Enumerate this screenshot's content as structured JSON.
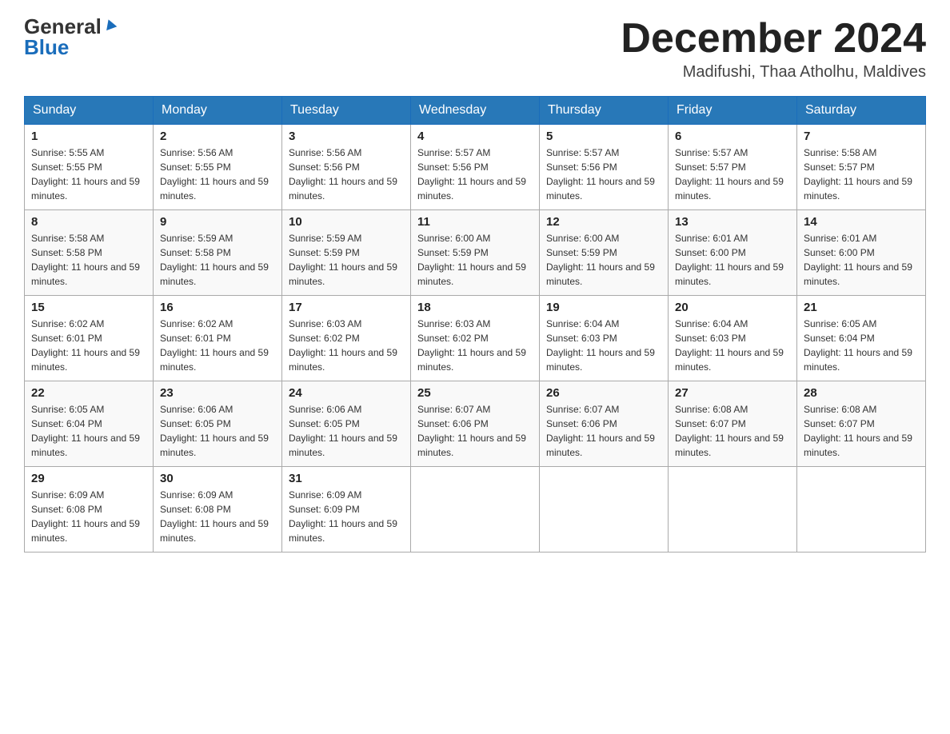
{
  "header": {
    "logo_general": "General",
    "logo_blue": "Blue",
    "title": "December 2024",
    "subtitle": "Madifushi, Thaa Atholhu, Maldives"
  },
  "weekdays": [
    "Sunday",
    "Monday",
    "Tuesday",
    "Wednesday",
    "Thursday",
    "Friday",
    "Saturday"
  ],
  "weeks": [
    [
      {
        "day": "1",
        "sunrise": "5:55 AM",
        "sunset": "5:55 PM",
        "daylight": "11 hours and 59 minutes."
      },
      {
        "day": "2",
        "sunrise": "5:56 AM",
        "sunset": "5:55 PM",
        "daylight": "11 hours and 59 minutes."
      },
      {
        "day": "3",
        "sunrise": "5:56 AM",
        "sunset": "5:56 PM",
        "daylight": "11 hours and 59 minutes."
      },
      {
        "day": "4",
        "sunrise": "5:57 AM",
        "sunset": "5:56 PM",
        "daylight": "11 hours and 59 minutes."
      },
      {
        "day": "5",
        "sunrise": "5:57 AM",
        "sunset": "5:56 PM",
        "daylight": "11 hours and 59 minutes."
      },
      {
        "day": "6",
        "sunrise": "5:57 AM",
        "sunset": "5:57 PM",
        "daylight": "11 hours and 59 minutes."
      },
      {
        "day": "7",
        "sunrise": "5:58 AM",
        "sunset": "5:57 PM",
        "daylight": "11 hours and 59 minutes."
      }
    ],
    [
      {
        "day": "8",
        "sunrise": "5:58 AM",
        "sunset": "5:58 PM",
        "daylight": "11 hours and 59 minutes."
      },
      {
        "day": "9",
        "sunrise": "5:59 AM",
        "sunset": "5:58 PM",
        "daylight": "11 hours and 59 minutes."
      },
      {
        "day": "10",
        "sunrise": "5:59 AM",
        "sunset": "5:59 PM",
        "daylight": "11 hours and 59 minutes."
      },
      {
        "day": "11",
        "sunrise": "6:00 AM",
        "sunset": "5:59 PM",
        "daylight": "11 hours and 59 minutes."
      },
      {
        "day": "12",
        "sunrise": "6:00 AM",
        "sunset": "5:59 PM",
        "daylight": "11 hours and 59 minutes."
      },
      {
        "day": "13",
        "sunrise": "6:01 AM",
        "sunset": "6:00 PM",
        "daylight": "11 hours and 59 minutes."
      },
      {
        "day": "14",
        "sunrise": "6:01 AM",
        "sunset": "6:00 PM",
        "daylight": "11 hours and 59 minutes."
      }
    ],
    [
      {
        "day": "15",
        "sunrise": "6:02 AM",
        "sunset": "6:01 PM",
        "daylight": "11 hours and 59 minutes."
      },
      {
        "day": "16",
        "sunrise": "6:02 AM",
        "sunset": "6:01 PM",
        "daylight": "11 hours and 59 minutes."
      },
      {
        "day": "17",
        "sunrise": "6:03 AM",
        "sunset": "6:02 PM",
        "daylight": "11 hours and 59 minutes."
      },
      {
        "day": "18",
        "sunrise": "6:03 AM",
        "sunset": "6:02 PM",
        "daylight": "11 hours and 59 minutes."
      },
      {
        "day": "19",
        "sunrise": "6:04 AM",
        "sunset": "6:03 PM",
        "daylight": "11 hours and 59 minutes."
      },
      {
        "day": "20",
        "sunrise": "6:04 AM",
        "sunset": "6:03 PM",
        "daylight": "11 hours and 59 minutes."
      },
      {
        "day": "21",
        "sunrise": "6:05 AM",
        "sunset": "6:04 PM",
        "daylight": "11 hours and 59 minutes."
      }
    ],
    [
      {
        "day": "22",
        "sunrise": "6:05 AM",
        "sunset": "6:04 PM",
        "daylight": "11 hours and 59 minutes."
      },
      {
        "day": "23",
        "sunrise": "6:06 AM",
        "sunset": "6:05 PM",
        "daylight": "11 hours and 59 minutes."
      },
      {
        "day": "24",
        "sunrise": "6:06 AM",
        "sunset": "6:05 PM",
        "daylight": "11 hours and 59 minutes."
      },
      {
        "day": "25",
        "sunrise": "6:07 AM",
        "sunset": "6:06 PM",
        "daylight": "11 hours and 59 minutes."
      },
      {
        "day": "26",
        "sunrise": "6:07 AM",
        "sunset": "6:06 PM",
        "daylight": "11 hours and 59 minutes."
      },
      {
        "day": "27",
        "sunrise": "6:08 AM",
        "sunset": "6:07 PM",
        "daylight": "11 hours and 59 minutes."
      },
      {
        "day": "28",
        "sunrise": "6:08 AM",
        "sunset": "6:07 PM",
        "daylight": "11 hours and 59 minutes."
      }
    ],
    [
      {
        "day": "29",
        "sunrise": "6:09 AM",
        "sunset": "6:08 PM",
        "daylight": "11 hours and 59 minutes."
      },
      {
        "day": "30",
        "sunrise": "6:09 AM",
        "sunset": "6:08 PM",
        "daylight": "11 hours and 59 minutes."
      },
      {
        "day": "31",
        "sunrise": "6:09 AM",
        "sunset": "6:09 PM",
        "daylight": "11 hours and 59 minutes."
      },
      null,
      null,
      null,
      null
    ]
  ]
}
